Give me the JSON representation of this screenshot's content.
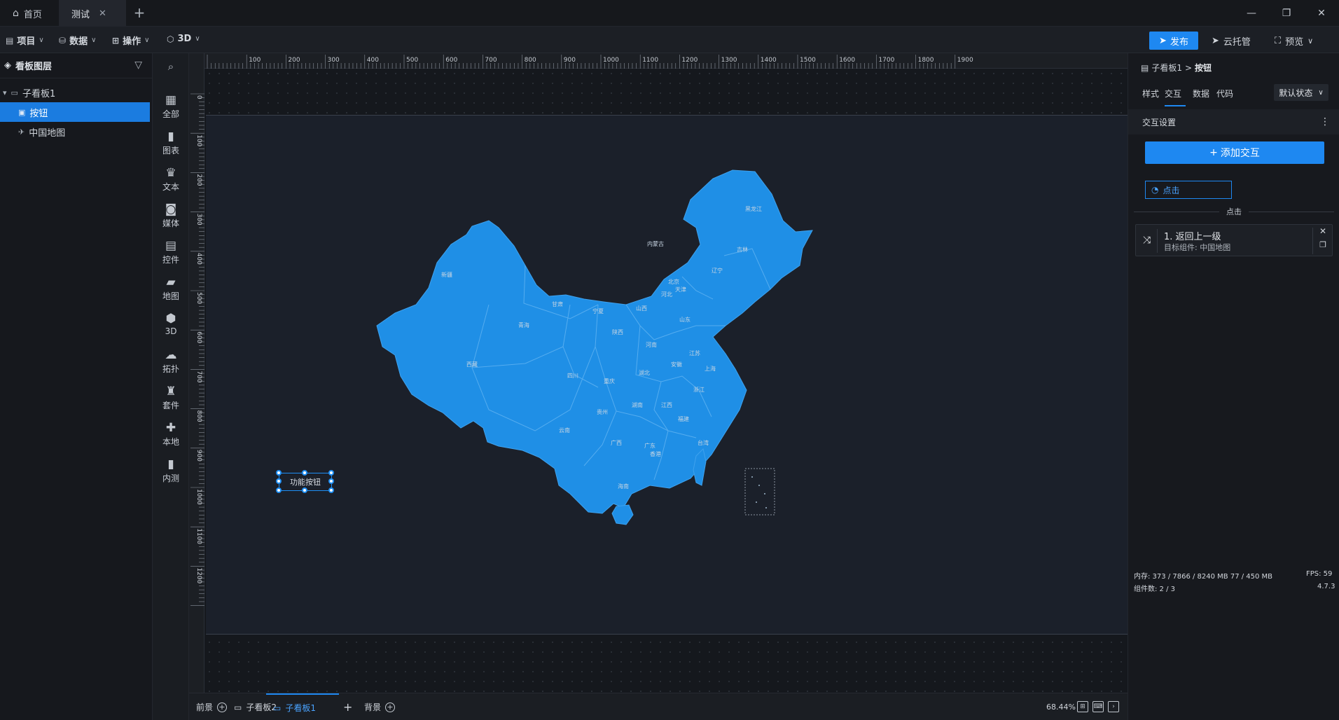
{
  "titlebar": {
    "tabs": [
      {
        "label": "首页",
        "active": false,
        "icon": "home-icon"
      },
      {
        "label": "测试",
        "active": true
      }
    ],
    "add_tab": "+",
    "window": {
      "minimize": "—",
      "restore": "❐",
      "close": "✕"
    }
  },
  "toolbar": {
    "menus": [
      {
        "label": "项目",
        "icon": "file-icon"
      },
      {
        "label": "数据",
        "icon": "database-icon"
      },
      {
        "label": "操作",
        "icon": "grid-icon"
      },
      {
        "label": "3D",
        "icon": "cube-icon"
      }
    ],
    "publish": "发布",
    "cloud": "云托管",
    "preview": "预览"
  },
  "layers": {
    "title": "看板图层",
    "items": [
      {
        "label": "子看板1",
        "level": 0,
        "expanded": true
      },
      {
        "label": "按钮",
        "level": 1,
        "selected": true
      },
      {
        "label": "中国地图",
        "level": 1,
        "selected": false
      }
    ]
  },
  "strip": {
    "items": [
      {
        "label": "全部",
        "icon": "all-icon"
      },
      {
        "label": "图表",
        "icon": "chart-icon"
      },
      {
        "label": "文本",
        "icon": "text-icon"
      },
      {
        "label": "媒体",
        "icon": "media-icon"
      },
      {
        "label": "控件",
        "icon": "control-icon"
      },
      {
        "label": "地图",
        "icon": "map-icon"
      },
      {
        "label": "3D",
        "icon": "cube-icon"
      },
      {
        "label": "拓扑",
        "icon": "topology-icon"
      },
      {
        "label": "套件",
        "icon": "kit-icon"
      },
      {
        "label": "本地",
        "icon": "local-icon"
      },
      {
        "label": "内测",
        "icon": "beta-icon"
      }
    ]
  },
  "ruler": {
    "top_ticks": [
      "100",
      "200",
      "300",
      "400",
      "500",
      "600",
      "700",
      "800",
      "900",
      "1000",
      "1100",
      "1200",
      "1300",
      "1400",
      "1500",
      "1600",
      "1700",
      "1800",
      "1900"
    ],
    "left_ticks": [
      "0",
      "100",
      "200",
      "300",
      "400",
      "500",
      "600",
      "700",
      "800",
      "900",
      "1000",
      "1100",
      "1200"
    ]
  },
  "canvas": {
    "button_label": "功能按钮",
    "map_color": "#1f8fe6",
    "provinces": [
      "新疆",
      "西藏",
      "青海",
      "甘肃",
      "内蒙古",
      "黑龙江",
      "吉林",
      "辽宁",
      "北京",
      "天津",
      "河北",
      "山西",
      "宁夏",
      "陕西",
      "山东",
      "河南",
      "江苏",
      "安徽",
      "上海",
      "湖北",
      "四川",
      "重庆",
      "浙江",
      "湖南",
      "江西",
      "贵州",
      "云南",
      "广西",
      "广东",
      "福建",
      "台湾",
      "香港",
      "海南"
    ]
  },
  "bottombar": {
    "tabs": [
      {
        "label": "前景",
        "add": true
      },
      {
        "label": "子看板2",
        "icon": "board-icon"
      },
      {
        "label": "子看板1",
        "icon": "board-icon",
        "active": true
      },
      {
        "label": "背景",
        "add": true
      }
    ],
    "add": "+",
    "zoom": "68.44%"
  },
  "rpanel": {
    "crumb_parent": "子看板1",
    "crumb_sep": ">",
    "crumb_child": "按钮",
    "tabs": [
      {
        "label": "样式"
      },
      {
        "label": "交互",
        "active": true
      },
      {
        "label": "数据"
      },
      {
        "label": "代码"
      }
    ],
    "state": "默认状态",
    "section": "交互设置",
    "add_interaction": "添加交互",
    "trigger": "点击",
    "divider": "点击",
    "action": {
      "title": "1. 返回上一级",
      "target": "目标组件: 中国地图"
    },
    "footer": {
      "memory": "内存:  373 / 7866 / 8240 MB  77 / 450 MB",
      "fps": "FPS:  59",
      "count": "组件数: 2 / 3",
      "version": "4.7.3"
    }
  }
}
